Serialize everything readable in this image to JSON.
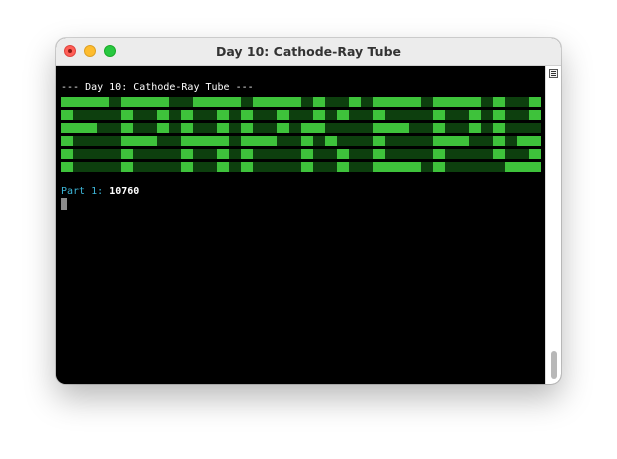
{
  "window": {
    "title": "Day 10: Cathode-Ray Tube"
  },
  "terminal": {
    "heading": "--- Day 10: Cathode-Ray Tube ---",
    "crt_rows": [
      "1111.1111..1111.1111.1..1.1111.1111.1..1.11..",
      "1....1..1.1..1.1..1..1.1..1....1..1.1..1.1..1",
      "111..1..1.1..1.1..1.11....111..1..1.1....1..1",
      "1....111..1111.111..1.1...1....111..1.11.1111",
      "1....1....1..1.1....1..1..1....1....1..1.1..1",
      "1....1....1..1.1....1..1..1111.1.....111.1..1"
    ],
    "crt_colors": {
      "on": "#3ec23b",
      "off": "#0d3f0e"
    },
    "part_label": "Part 1:",
    "part_value": "10760",
    "accent_color": "#3db6d8"
  },
  "icons": {
    "close": "close-icon",
    "scroll_menu": "list-icon"
  }
}
